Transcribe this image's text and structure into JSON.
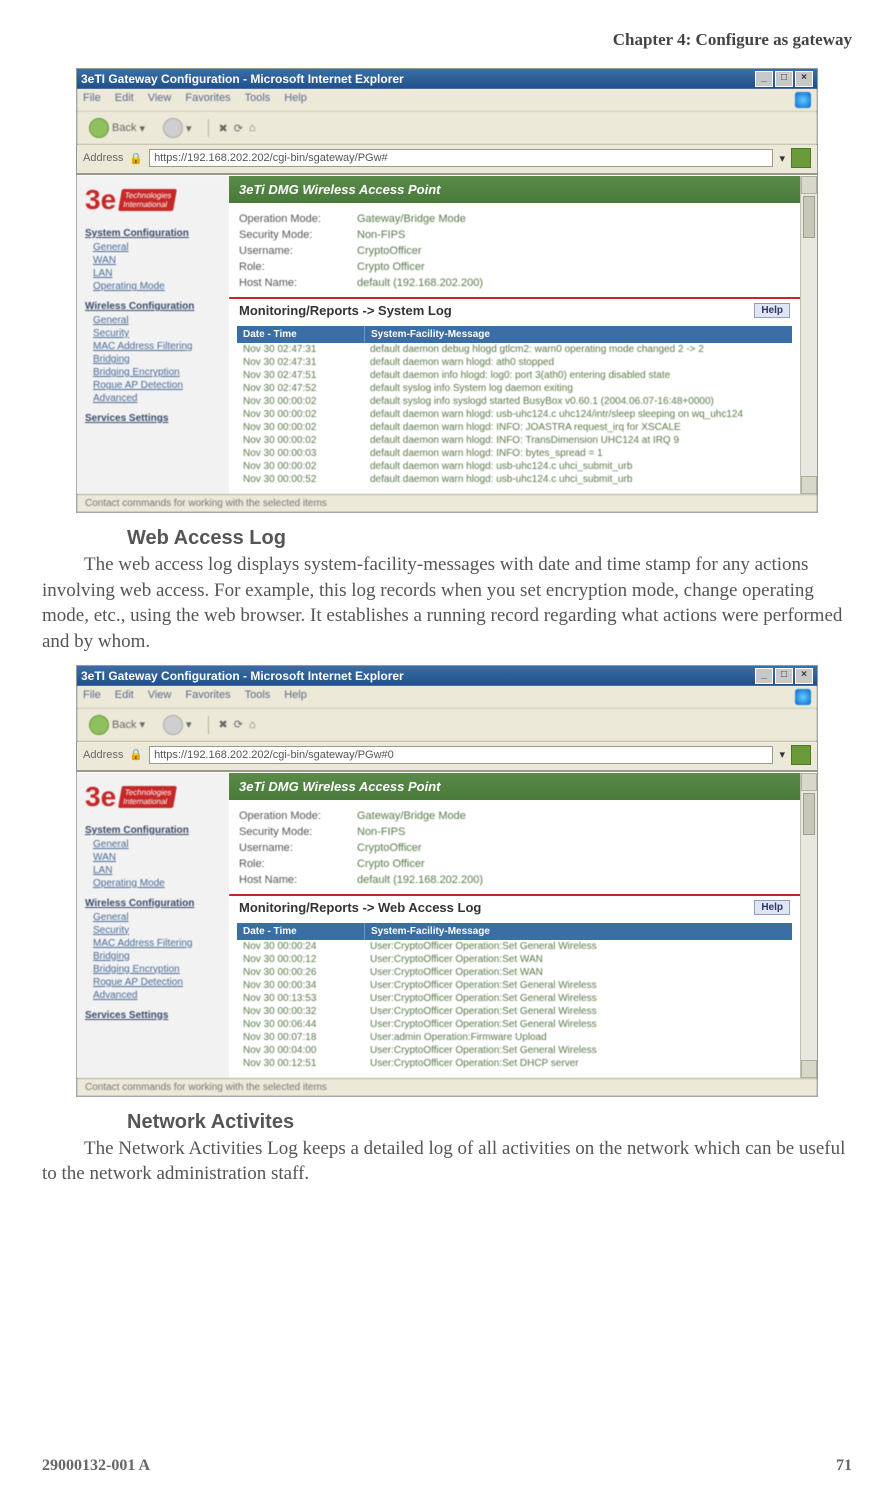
{
  "page": {
    "chapter": "Chapter 4: Configure as gateway",
    "doc_id": "29000132-001 A",
    "page_no": "71"
  },
  "section1": {
    "heading": "Web Access Log",
    "body": "The web access log displays system-facility-messages with date and time stamp for any actions involving web access. For example, this log records when you set encryption mode, change operating mode, etc., using the web browser. It establishes a running record regarding what actions were performed and by whom."
  },
  "section2": {
    "heading": "Network Activites",
    "body": "The Network Activities Log keeps a detailed log of all activities on the network which can be useful to the network administration staff."
  },
  "shot_common": {
    "title": "3eTI Gateway Configuration - Microsoft Internet Explorer",
    "menu": {
      "file": "File",
      "edit": "Edit",
      "view": "View",
      "favorites": "Favorites",
      "tools": "Tools",
      "help": "Help"
    },
    "toolbar": {
      "back": "Back"
    },
    "addr_label": "Address",
    "banner": "3eTi DMG Wireless Access Point",
    "info": {
      "op_mode_k": "Operation Mode:",
      "op_mode_v": "Gateway/Bridge Mode",
      "sec_mode_k": "Security Mode:",
      "sec_mode_v": "Non-FIPS",
      "user_k": "Username:",
      "user_v": "CryptoOfficer",
      "role_k": "Role:",
      "role_v": "Crypto Officer",
      "host_k": "Host Name:",
      "host_v": "default (192.168.202.200)"
    },
    "tbl_hdr1": "Date - Time",
    "tbl_hdr2": "System-Facility-Message",
    "help": "Help",
    "status": "Contact commands for working with the selected items"
  },
  "shot1": {
    "url": "https://192.168.202.202/cgi-bin/sgateway/PGw#",
    "section": "Monitoring/Reports -> System Log",
    "sidebar": {
      "grp1": "System Configuration",
      "items1": [
        "General",
        "WAN",
        "LAN",
        "Operating Mode"
      ],
      "grp2": "Wireless Configuration",
      "items2": [
        "General",
        "Security",
        "MAC Address Filtering",
        "Bridging",
        "Bridging Encryption",
        "Rogue AP Detection",
        "Advanced"
      ],
      "grp3": "Services Settings"
    },
    "rows": [
      {
        "t": "Nov 30 02:47:31",
        "m": "default daemon debug hlogd gtlcm2: warn0 operating mode changed 2 -> 2"
      },
      {
        "t": "Nov 30 02:47:31",
        "m": "default daemon warn hlogd: ath0 stopped"
      },
      {
        "t": "Nov 30 02:47:51",
        "m": "default daemon info hlogd: log0: port 3(ath0) entering disabled state"
      },
      {
        "t": "Nov 30 02:47:52",
        "m": "default syslog info System log daemon exiting"
      },
      {
        "t": "Nov 30 00:00:02",
        "m": "default syslog info syslogd started BusyBox v0.60.1 (2004.06.07-16:48+0000)"
      },
      {
        "t": "Nov 30 00:00:02",
        "m": "default daemon warn hlogd: usb-uhc124.c uhc124/intr/sleep sleeping on wq_uhc124"
      },
      {
        "t": "Nov 30 00:00:02",
        "m": "default daemon warn hlogd: INFO: JOASTRA request_irq for XSCALE"
      },
      {
        "t": "Nov 30 00:00:02",
        "m": "default daemon warn hlogd: INFO: TransDimension UHC124 at IRQ 9"
      },
      {
        "t": "Nov 30 00:00:03",
        "m": "default daemon warn hlogd: INFO: bytes_spread = 1"
      },
      {
        "t": "Nov 30 00:00:02",
        "m": "default daemon warn hlogd: usb-uhc124.c uhci_submit_urb"
      },
      {
        "t": "Nov 30 00:00:52",
        "m": "default daemon warn hlogd: usb-uhc124.c uhci_submit_urb"
      }
    ]
  },
  "shot2": {
    "url": "https://192.168.202.202/cgi-bin/sgateway/PGw#0",
    "section": "Monitoring/Reports -> Web Access Log",
    "sidebar": {
      "grp1": "System Configuration",
      "items1": [
        "General",
        "WAN",
        "LAN",
        "Operating Mode"
      ],
      "grp2": "Wireless Configuration",
      "items2": [
        "General",
        "Security",
        "MAC Address Filtering",
        "Bridging",
        "Bridging Encryption",
        "Rogue AP Detection",
        "Advanced"
      ],
      "grp3": "Services Settings"
    },
    "rows": [
      {
        "t": "Nov 30 00:00:24",
        "m": "User:CryptoOfficer Operation:Set General Wireless"
      },
      {
        "t": "Nov 30 00:00:12",
        "m": "User:CryptoOfficer Operation:Set WAN"
      },
      {
        "t": "Nov 30 00:00:26",
        "m": "User:CryptoOfficer Operation:Set WAN"
      },
      {
        "t": "Nov 30 00:00:34",
        "m": "User:CryptoOfficer Operation:Set General Wireless"
      },
      {
        "t": "Nov 30 00:13:53",
        "m": "User:CryptoOfficer Operation:Set General Wireless"
      },
      {
        "t": "Nov 30 00:00:32",
        "m": "User:CryptoOfficer Operation:Set General Wireless"
      },
      {
        "t": "Nov 30 00:06:44",
        "m": "User:CryptoOfficer Operation:Set General Wireless"
      },
      {
        "t": "Nov 30 00:07:18",
        "m": "User:admin Operation:Firmware Upload"
      },
      {
        "t": "Nov 30 00:04:00",
        "m": "User:CryptoOfficer Operation:Set General Wireless"
      },
      {
        "t": "Nov 30 00:12:51",
        "m": "User:CryptoOfficer Operation:Set DHCP server"
      }
    ]
  }
}
